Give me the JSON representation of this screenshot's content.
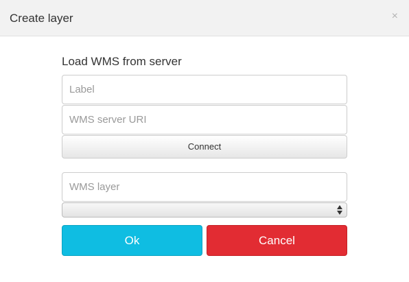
{
  "dialog": {
    "title": "Create layer",
    "close_label": "×"
  },
  "form": {
    "heading": "Load WMS from server",
    "label_field": {
      "placeholder": "Label",
      "value": ""
    },
    "uri_field": {
      "placeholder": "WMS server URI",
      "value": ""
    },
    "connect_label": "Connect",
    "layer_field": {
      "placeholder": "WMS layer",
      "value": ""
    },
    "layer_select": {
      "selected": ""
    }
  },
  "actions": {
    "ok_label": "Ok",
    "cancel_label": "Cancel"
  },
  "colors": {
    "ok": "#0fbde2",
    "cancel": "#e22c33",
    "header_bg": "#f2f2f2"
  },
  "icons": {
    "close": "close-icon",
    "select_arrows": "select-arrows-icon"
  }
}
